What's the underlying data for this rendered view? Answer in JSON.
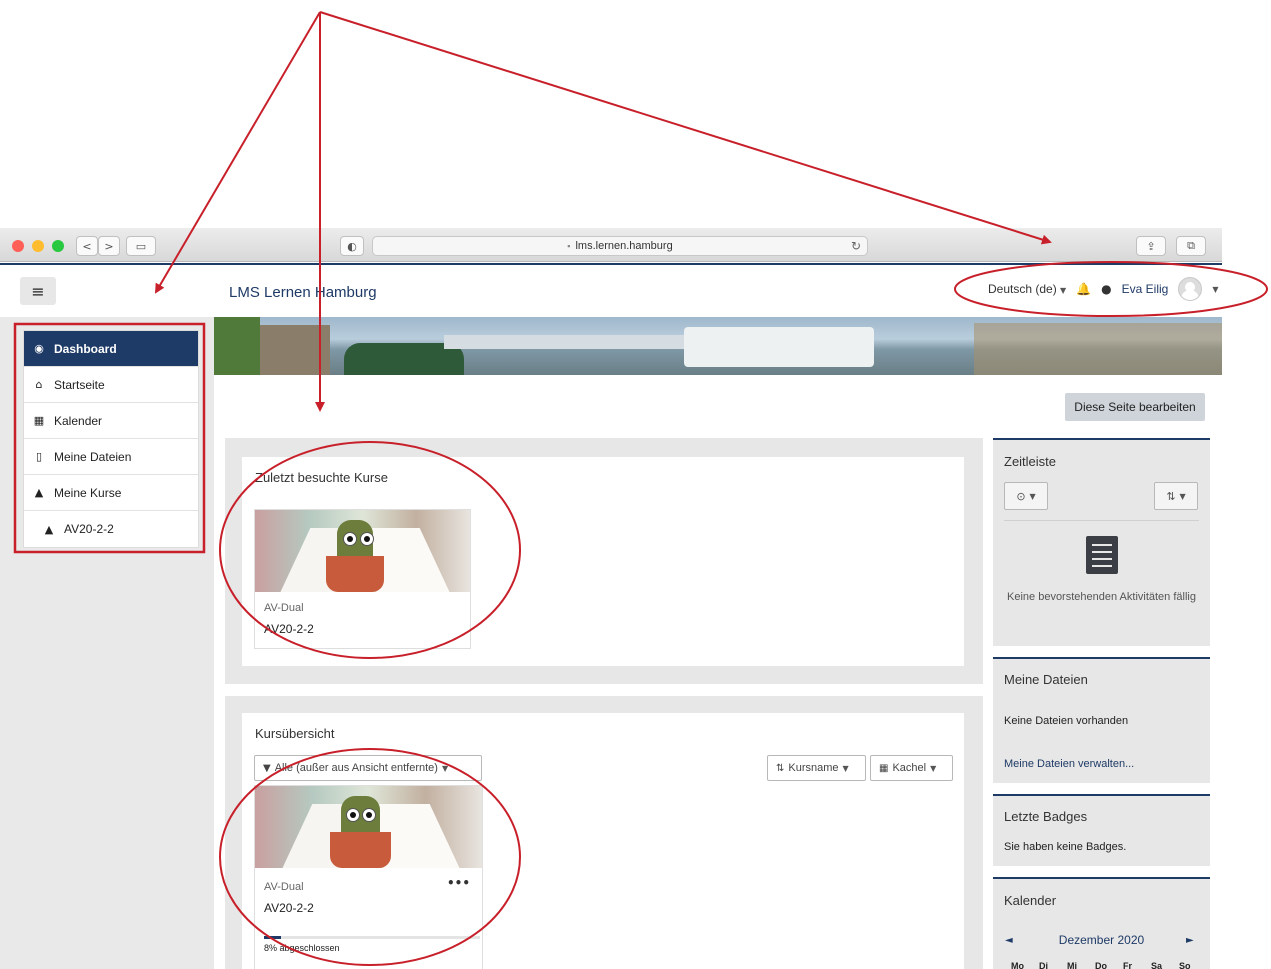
{
  "browser": {
    "url": "lms.lernen.hamburg",
    "lock_icon": "lock-icon",
    "colors": {
      "close": "#fe5f57",
      "minimize": "#febc2e",
      "maximize": "#28c840"
    }
  },
  "navbar": {
    "menu_icon": "≡",
    "site_name": "LMS Lernen Hamburg",
    "language": "Deutsch (de)",
    "user_name": "Eva Eilig"
  },
  "drawer": {
    "items": [
      {
        "label": "Dashboard",
        "icon": "dashboard-icon"
      },
      {
        "label": "Startseite",
        "icon": "home-icon"
      },
      {
        "label": "Kalender",
        "icon": "calendar-icon"
      },
      {
        "label": "Meine Dateien",
        "icon": "file-icon"
      },
      {
        "label": "Meine Kurse",
        "icon": "graduation-cap-icon"
      },
      {
        "label": "AV20-2-2",
        "icon": "graduation-cap-icon"
      }
    ]
  },
  "page": {
    "edit_button": "Diese Seite bearbeiten"
  },
  "recent": {
    "title": "Zuletzt besuchte Kurse",
    "course": {
      "category": "AV-Dual",
      "name": "AV20-2-2"
    }
  },
  "overview": {
    "title": "Kursübersicht",
    "filter": "Alle (außer aus Ansicht entfernte)",
    "sort": "Kursname",
    "view": "Kachel",
    "course": {
      "category": "AV-Dual",
      "name": "AV20-2-2",
      "menu": "•••",
      "progress": 0.08,
      "progress_label": "8% abgeschlossen"
    }
  },
  "timeline": {
    "title": "Zeitleiste",
    "empty": "Keine bevorstehenden Aktivitäten fällig"
  },
  "files": {
    "title": "Meine Dateien",
    "empty": "Keine Dateien vorhanden",
    "manage_link": "Meine Dateien verwalten..."
  },
  "badges": {
    "title": "Letzte Badges",
    "empty": "Sie haben keine Badges."
  },
  "calendar": {
    "title": "Kalender",
    "prev": "◄",
    "next": "►",
    "month": "Dezember 2020",
    "days": [
      "Mo",
      "Di",
      "Mi",
      "Do",
      "Fr",
      "Sa",
      "So"
    ]
  },
  "annotation_color": "#c8202a",
  "accent": "#1e3a66"
}
